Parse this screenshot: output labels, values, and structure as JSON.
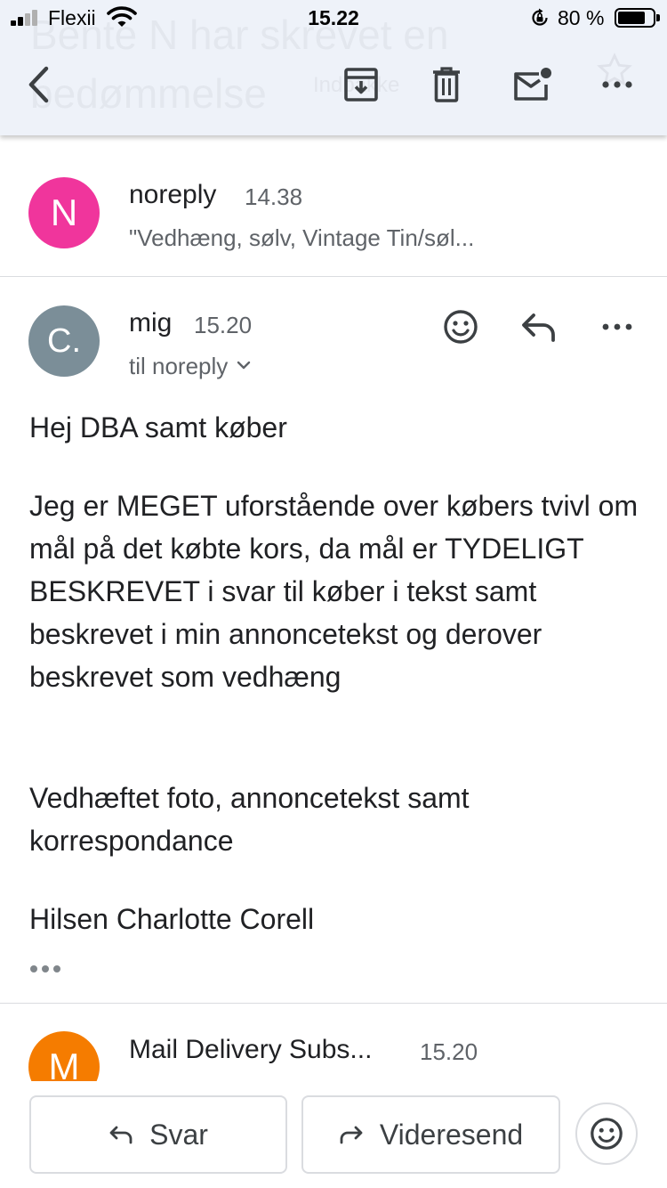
{
  "status_bar": {
    "carrier": "Flexii",
    "time": "15.22",
    "battery_percent_label": "80 %",
    "battery_level": 0.8
  },
  "toolbar": {
    "ghost_subject": "Bente N har skrevet en bedømmelse",
    "ghost_label": "Indbakke",
    "icons": [
      "back-icon",
      "archive-icon",
      "trash-icon",
      "mark-unread-icon",
      "more-icon",
      "star-icon"
    ]
  },
  "messages": [
    {
      "avatar_letter": "N",
      "avatar_color": "#f0359c",
      "sender": "noreply",
      "time": "14.38",
      "snippet": "\"Vedhæng, sølv, Vintage Tin/søl..."
    },
    {
      "avatar_letter": "C.",
      "avatar_color": "#7b8e98",
      "sender": "mig",
      "time": "15.20",
      "recipient": "til noreply",
      "body": [
        "Hej DBA samt køber",
        "Jeg er MEGET uforstående over købers tvivl om mål på det købte kors, da mål er TYDELIGT BESKREVET i svar til køber i tekst samt beskrevet i min annoncetekst og derover beskrevet som vedhæng",
        "Vedhæftet foto, annoncetekst samt korrespondance",
        "Hilsen Charlotte Corell"
      ]
    },
    {
      "avatar_letter": "M",
      "avatar_color": "#f57c00",
      "sender": "Mail Delivery Subs...",
      "time": "15.20"
    }
  ],
  "bottom_bar": {
    "reply_label": "Svar",
    "forward_label": "Videresend"
  }
}
